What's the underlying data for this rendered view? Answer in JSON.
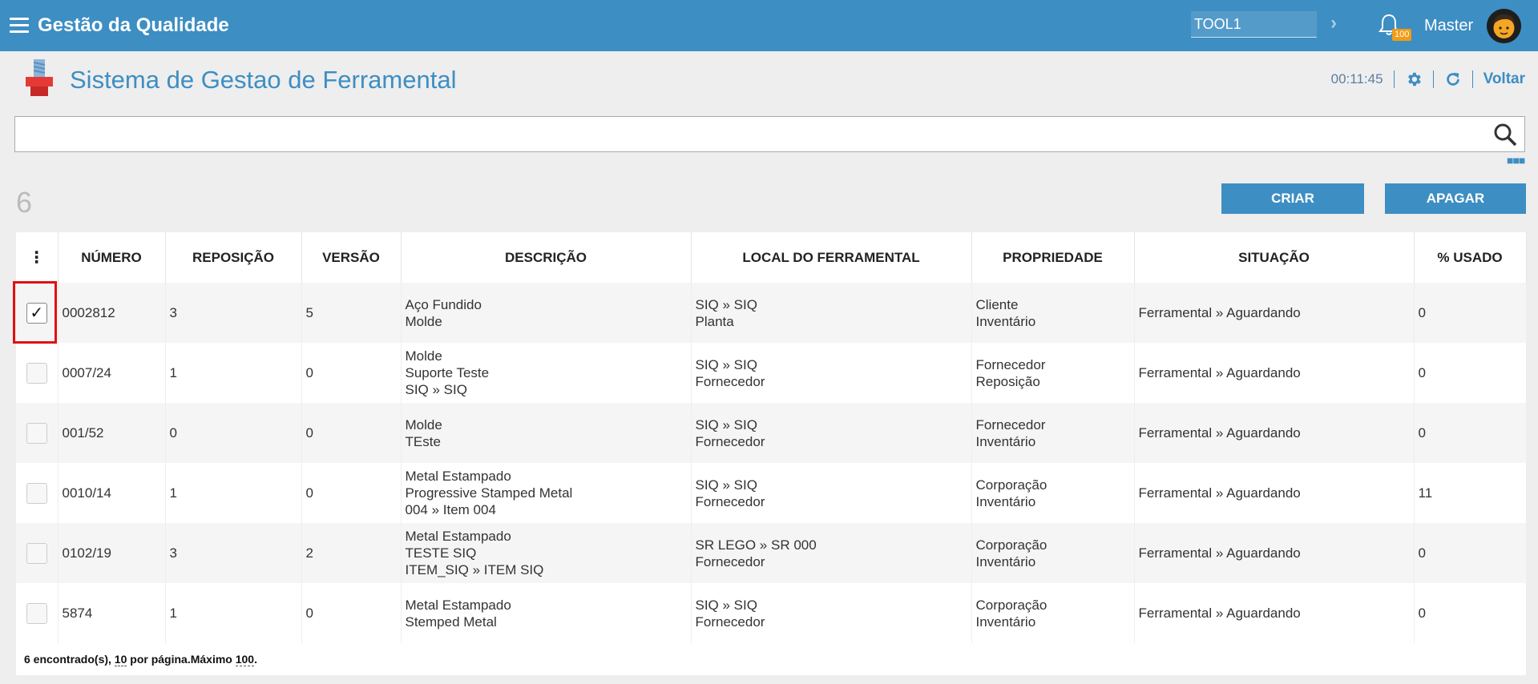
{
  "topbar": {
    "app_title": "Gestão da Qualidade",
    "plant_value": "TOOL1",
    "notification_count": "100",
    "user_name": "Master"
  },
  "header": {
    "title": "Sistema de Gestao de Ferramental",
    "time": "00:11:45",
    "back_label": "Voltar"
  },
  "search": {
    "value": "",
    "placeholder": ""
  },
  "toolbar": {
    "count": "6",
    "create_label": "CRIAR",
    "delete_label": "APAGAR"
  },
  "table": {
    "columns": [
      "NÚMERO",
      "REPOSIÇÃO",
      "VERSÃO",
      "DESCRIÇÃO",
      "LOCAL DO FERRAMENTAL",
      "PROPRIEDADE",
      "SITUAÇÃO",
      "% USADO"
    ],
    "rows": [
      {
        "checked": true,
        "numero": "0002812",
        "reposicao": "3",
        "versao": "5",
        "descricao": [
          "Aço Fundido",
          "Molde"
        ],
        "local": [
          "SIQ » SIQ",
          "Planta"
        ],
        "propriedade": [
          "Cliente",
          "Inventário"
        ],
        "situacao": "Ferramental » Aguardando",
        "usado": "0"
      },
      {
        "checked": false,
        "numero": "0007/24",
        "reposicao": "1",
        "versao": "0",
        "descricao": [
          "Molde",
          "Suporte Teste",
          "SIQ » SIQ"
        ],
        "local": [
          "SIQ » SIQ",
          "Fornecedor"
        ],
        "propriedade": [
          "Fornecedor",
          "Reposição"
        ],
        "situacao": "Ferramental » Aguardando",
        "usado": "0"
      },
      {
        "checked": false,
        "numero": "001/52",
        "reposicao": "0",
        "versao": "0",
        "descricao": [
          "Molde",
          "TEste"
        ],
        "local": [
          "SIQ » SIQ",
          "Fornecedor"
        ],
        "propriedade": [
          "Fornecedor",
          "Inventário"
        ],
        "situacao": "Ferramental » Aguardando",
        "usado": "0"
      },
      {
        "checked": false,
        "numero": "0010/14",
        "reposicao": "1",
        "versao": "0",
        "descricao": [
          "Metal Estampado",
          "Progressive Stamped Metal",
          "004 » Item 004"
        ],
        "local": [
          "SIQ » SIQ",
          "Fornecedor"
        ],
        "propriedade": [
          "Corporação",
          "Inventário"
        ],
        "situacao": "Ferramental » Aguardando",
        "usado": "11"
      },
      {
        "checked": false,
        "numero": "0102/19",
        "reposicao": "3",
        "versao": "2",
        "descricao": [
          "Metal Estampado",
          "TESTE SIQ",
          "ITEM_SIQ » ITEM SIQ"
        ],
        "local": [
          "SR LEGO » SR 000",
          "Fornecedor"
        ],
        "propriedade": [
          "Corporação",
          "Inventário"
        ],
        "situacao": "Ferramental » Aguardando",
        "usado": "0"
      },
      {
        "checked": false,
        "numero": "5874",
        "reposicao": "1",
        "versao": "0",
        "descricao": [
          "Metal Estampado",
          "Stemped Metal"
        ],
        "local": [
          "SIQ » SIQ",
          "Fornecedor"
        ],
        "propriedade": [
          "Corporação",
          "Inventário"
        ],
        "situacao": "Ferramental » Aguardando",
        "usado": "0"
      }
    ]
  },
  "footer": {
    "found_text": "6 encontrado(s), ",
    "per_page_value": "10",
    "per_page_text": " por página.Máximo ",
    "max_value": "100",
    "end_text": "."
  },
  "colors": {
    "primary": "#3d8ec3",
    "highlight": "#e01010"
  },
  "icons": [
    "menu-icon",
    "chevron-right-icon",
    "bell-icon",
    "avatar",
    "tool-icon",
    "gear-icon",
    "refresh-icon",
    "search-icon",
    "more-icon",
    "kebab-icon",
    "check-icon"
  ]
}
